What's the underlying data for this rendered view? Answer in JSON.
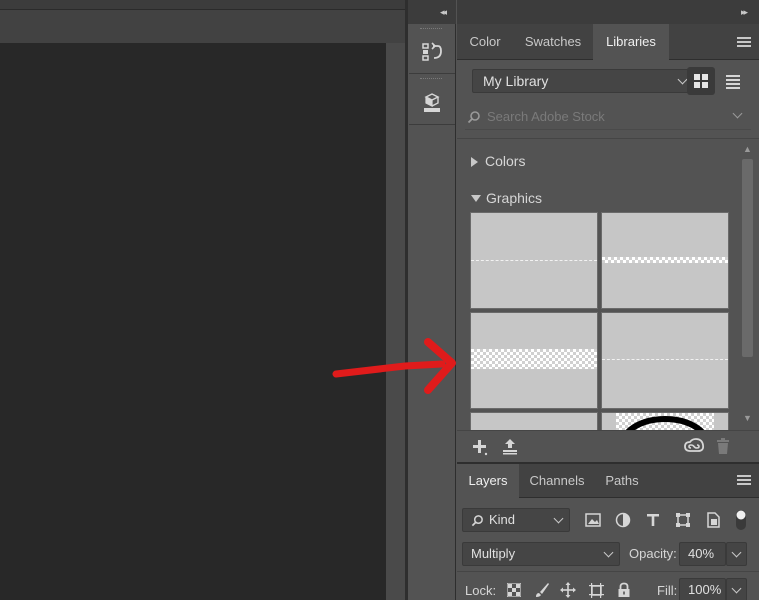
{
  "panel": {
    "tabs": [
      {
        "label": "Color"
      },
      {
        "label": "Swatches"
      },
      {
        "label": "Libraries"
      }
    ],
    "library_select": "My Library",
    "search_placeholder": "Search Adobe Stock",
    "sections": {
      "colors": "Colors",
      "graphics": "Graphics"
    }
  },
  "layers": {
    "tabs": [
      {
        "label": "Layers"
      },
      {
        "label": "Channels"
      },
      {
        "label": "Paths"
      }
    ],
    "filter_kind": "Kind",
    "blend_mode": "Multiply",
    "opacity_label": "Opacity:",
    "opacity_value": "40%",
    "lock_label": "Lock:",
    "fill_label": "Fill:",
    "fill_value": "100%"
  },
  "colors": {
    "annotation_arrow": "#e01b1b",
    "panel_bg": "#535353",
    "canvas_bg": "#282828"
  }
}
